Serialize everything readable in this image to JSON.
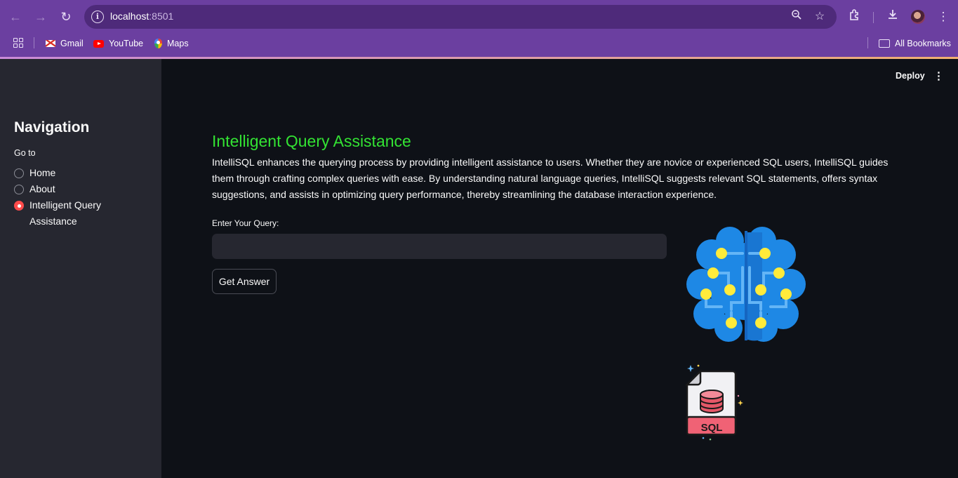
{
  "browser": {
    "url_host": "localhost",
    "url_port": ":8501",
    "bookmarks": [
      {
        "label": "Gmail",
        "icon": "gmail-icon"
      },
      {
        "label": "YouTube",
        "icon": "youtube-icon"
      },
      {
        "label": "Maps",
        "icon": "maps-icon"
      }
    ],
    "all_bookmarks_label": "All Bookmarks",
    "colors": {
      "frame": "#6b3fa0",
      "omnibox": "#4e2a7a"
    }
  },
  "sidebar": {
    "title": "Navigation",
    "radio_label": "Go to",
    "options": [
      {
        "label": "Home",
        "selected": false
      },
      {
        "label": "About",
        "selected": false
      },
      {
        "label": "Intelligent Query Assistance",
        "selected": true
      }
    ]
  },
  "header": {
    "deploy_label": "Deploy"
  },
  "main": {
    "title": "Intelligent Query Assistance",
    "description": "IntelliSQL enhances the querying process by providing intelligent assistance to users. Whether they are novice or experienced SQL users, IntelliSQL guides them through crafting complex queries with ease. By understanding natural language queries, IntelliSQL suggests relevant SQL statements, offers syntax suggestions, and assists in optimizing query performance, thereby streamlining the database interaction experience.",
    "query_label": "Enter Your Query:",
    "query_value": "",
    "button_label": "Get Answer",
    "sql_badge": "SQL",
    "colors": {
      "title": "#33e233",
      "accent": "#ff4b4b",
      "background": "#0e1117",
      "sidebar": "#262730"
    }
  }
}
